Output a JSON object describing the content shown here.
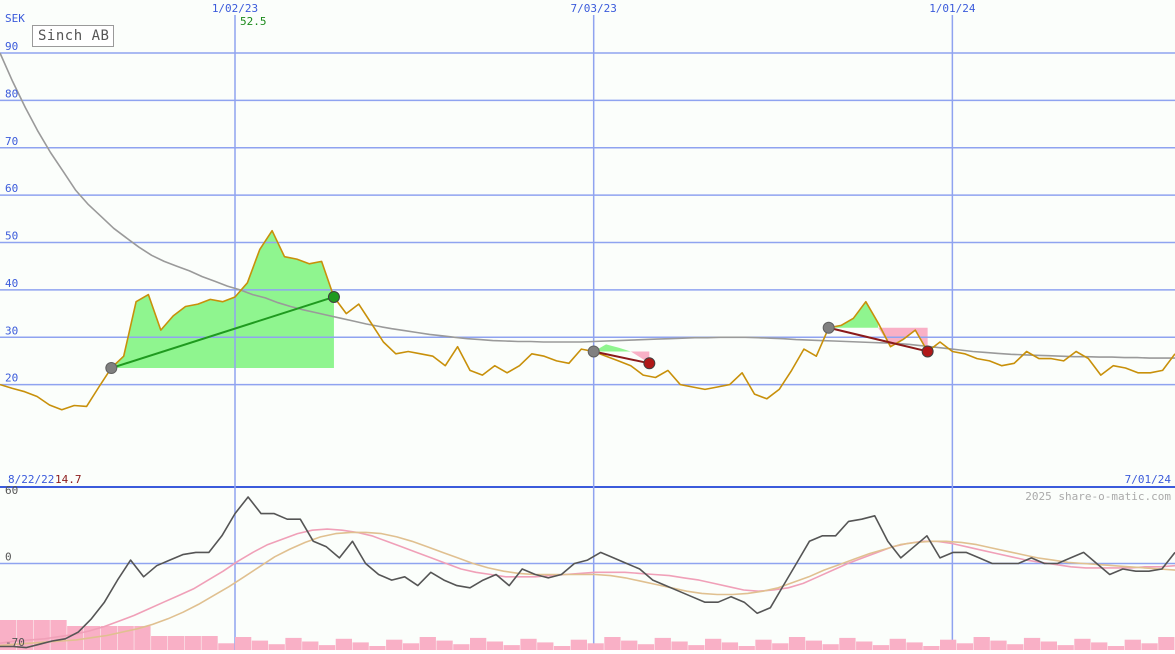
{
  "ticker": "Sinch AB",
  "currency_label": "SEK",
  "watermark": "2025 share-o-matic.com",
  "start_date_label": "8/22/22",
  "end_date_label": "7/01/24",
  "min_price_label": "14.7",
  "max_price_label": "52.5",
  "colors": {
    "price_line": "#c8900a",
    "moving_average": "#9a9a9a",
    "gridline": "#8fa3f0",
    "axis_text": "#3b5bdb",
    "gain_fill": "#8ff58f",
    "loss_fill": "#f9b0c6",
    "buy_trend": "#1f9a1f",
    "sell_trend": "#8b1a1a",
    "oscillator": "#555555",
    "signal_pink": "#f0a0b8",
    "signal_tan": "#e0c090",
    "volume": "#f9b0c6"
  },
  "chart_data": [
    {
      "type": "line",
      "title": "Sinch AB",
      "ylabel": "SEK",
      "ylim": [
        10,
        90
      ],
      "y_ticks": [
        20,
        30,
        40,
        50,
        60,
        70,
        80,
        90
      ],
      "x_ticks": [
        "1/02/23",
        "7/03/23",
        "1/01/24"
      ],
      "x_tick_index": [
        19,
        48,
        77
      ],
      "series": [
        {
          "values": [
            20.0,
            19.2,
            18.5,
            17.5,
            15.7,
            14.7,
            15.6,
            15.4,
            19.5,
            23.5,
            26.0,
            37.5,
            39.0,
            31.5,
            34.5,
            36.5,
            37.0,
            38.0,
            37.5,
            38.5,
            41.5,
            48.5,
            52.5,
            47.0,
            46.5,
            45.5,
            46.0,
            38.5,
            35.0,
            37.0,
            33.0,
            29.0,
            26.5,
            27.0,
            26.5,
            26.0,
            24.0,
            28.0,
            23.0,
            22.0,
            24.0,
            22.5,
            24.0,
            26.5,
            26.0,
            25.0,
            24.5,
            27.5,
            27.0,
            26.0,
            25.0,
            24.0,
            22.0,
            21.5,
            23.0,
            20.0,
            19.5,
            19.0,
            19.5,
            20.0,
            22.5,
            18.0,
            17.0,
            19.0,
            23.0,
            27.5,
            26.0,
            32.0,
            32.5,
            34.0,
            37.5,
            33.0,
            28.0,
            29.5,
            31.5,
            27.0,
            29.0,
            27.0,
            26.5,
            25.5,
            25.0,
            24.0,
            24.5,
            27.0,
            25.5,
            25.5,
            25.0,
            27.0,
            25.5,
            22.0,
            24.0,
            23.5,
            22.5,
            22.5,
            23.0,
            26.5
          ]
        },
        {
          "values": [
            90.0,
            84.0,
            78.5,
            73.5,
            69.0,
            65.0,
            61.0,
            58.0,
            55.5,
            53.0,
            51.0,
            49.0,
            47.3,
            46.0,
            45.0,
            44.0,
            42.8,
            41.8,
            40.8,
            40.0,
            39.0,
            38.3,
            37.3,
            36.5,
            35.8,
            35.2,
            34.6,
            34.0,
            33.4,
            32.8,
            32.3,
            31.8,
            31.4,
            31.0,
            30.6,
            30.3,
            30.0,
            29.7,
            29.5,
            29.3,
            29.2,
            29.1,
            29.1,
            29.0,
            29.0,
            29.0,
            29.0,
            29.1,
            29.2,
            29.3,
            29.4,
            29.5,
            29.6,
            29.7,
            29.8,
            29.9,
            29.9,
            30.0,
            30.0,
            30.0,
            29.9,
            29.8,
            29.7,
            29.5,
            29.4,
            29.3,
            29.2,
            29.1,
            29.0,
            28.9,
            28.8,
            28.7,
            28.5,
            28.2,
            27.9,
            27.6,
            27.3,
            27.0,
            26.8,
            26.6,
            26.4,
            26.3,
            26.2,
            26.1,
            26.0,
            25.9,
            25.9,
            25.8,
            25.8,
            25.7,
            25.7,
            25.6,
            25.6,
            25.6
          ]
        }
      ]
    },
    {
      "type": "line",
      "ylim": [
        -70,
        60
      ],
      "y_ticks": [
        60,
        0,
        -70
      ],
      "series": [
        {
          "values": [
            -75.0,
            -75.0,
            -76.0,
            -73.0,
            -70.0,
            -68.0,
            -62.0,
            -50.0,
            -35.0,
            -15.0,
            3.0,
            -12.0,
            -2.0,
            3.0,
            8.0,
            10.0,
            10.0,
            25.0,
            45.0,
            60.0,
            45.0,
            45.0,
            40.0,
            40.0,
            20.0,
            15.0,
            5.0,
            20.0,
            0.0,
            -10.0,
            -15.0,
            -12.0,
            -20.0,
            -8.0,
            -15.0,
            -20.0,
            -22.0,
            -15.0,
            -10.0,
            -20.0,
            -5.0,
            -10.0,
            -13.0,
            -10.0,
            0.0,
            3.0,
            10.0,
            5.0,
            0.0,
            -5.0,
            -15.0,
            -20.0,
            -25.0,
            -30.0,
            -35.0,
            -35.0,
            -30.0,
            -35.0,
            -45.0,
            -40.0,
            -20.0,
            0.0,
            20.0,
            25.0,
            25.0,
            38.0,
            40.0,
            43.0,
            20.0,
            5.0,
            15.0,
            25.0,
            5.0,
            10.0,
            10.0,
            5.0,
            0.0,
            0.0,
            0.0,
            5.0,
            0.0,
            0.0,
            5.0,
            10.0,
            0.0,
            -10.0,
            -5.0,
            -7.0,
            -7.0,
            -5.0,
            10.0
          ]
        },
        {
          "values": [
            -72.0,
            -70.0,
            -69.0,
            -68.0,
            -66.0,
            -64.0,
            -61.0,
            -57.0,
            -52.0,
            -47.0,
            -41.0,
            -35.0,
            -29.0,
            -23.0,
            -15.0,
            -7.0,
            2.0,
            10.0,
            17.0,
            22.0,
            27.0,
            30.0,
            31.0,
            30.0,
            28.0,
            25.0,
            20.0,
            15.0,
            10.0,
            5.0,
            0.0,
            -5.0,
            -8.0,
            -10.0,
            -12.0,
            -12.0,
            -12.0,
            -11.0,
            -10.0,
            -9.0,
            -8.0,
            -8.0,
            -8.0,
            -9.0,
            -10.0,
            -11.0,
            -13.0,
            -15.0,
            -18.0,
            -21.0,
            -24.0,
            -25.0,
            -24.0,
            -22.0,
            -18.0,
            -12.0,
            -6.0,
            0.0,
            5.0,
            10.0,
            15.0,
            18.0,
            20.0,
            20.0,
            18.0,
            15.0,
            12.0,
            9.0,
            6.0,
            3.0,
            1.0,
            -1.0,
            -3.0,
            -4.0,
            -4.0,
            -4.0,
            -4.0,
            -3.0,
            -3.0,
            -2.0
          ]
        },
        {
          "values": [
            -74.0,
            -73.0,
            -72.0,
            -71.0,
            -70.0,
            -69.0,
            -67.0,
            -65.0,
            -62.0,
            -59.0,
            -55.0,
            -50.0,
            -44.0,
            -37.0,
            -29.0,
            -21.0,
            -12.0,
            -3.0,
            6.0,
            13.0,
            19.0,
            24.0,
            27.0,
            28.0,
            28.0,
            27.0,
            24.0,
            20.0,
            15.0,
            10.0,
            5.0,
            0.0,
            -4.0,
            -7.0,
            -9.0,
            -10.0,
            -10.0,
            -10.0,
            -10.0,
            -10.0,
            -11.0,
            -13.0,
            -16.0,
            -19.0,
            -22.0,
            -25.0,
            -27.0,
            -28.0,
            -28.0,
            -27.0,
            -25.0,
            -22.0,
            -17.0,
            -12.0,
            -6.0,
            -1.0,
            4.0,
            9.0,
            13.0,
            17.0,
            19.0,
            20.0,
            20.0,
            19.0,
            17.0,
            14.0,
            11.0,
            8.0,
            5.0,
            3.0,
            1.0,
            0.0,
            -1.0,
            -2.0,
            -3.0,
            -4.0,
            -5.0,
            -6.0
          ]
        }
      ]
    }
  ]
}
